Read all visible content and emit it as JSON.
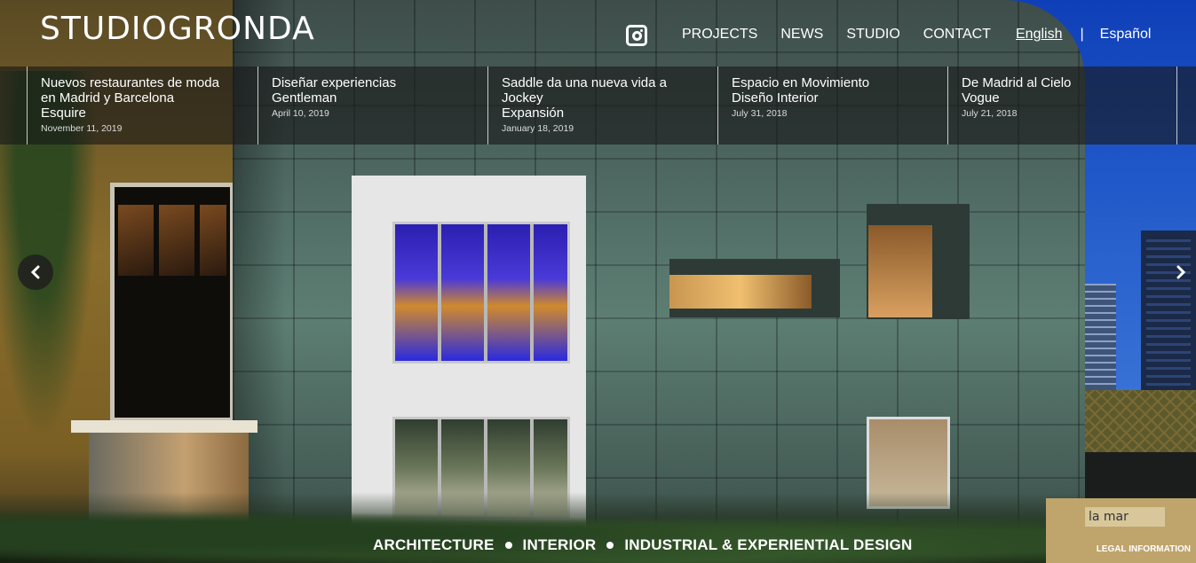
{
  "header": {
    "logo": "STUDIOGRONDA",
    "nav": [
      "PROJECTS",
      "NEWS",
      "STUDIO",
      "CONTACT"
    ],
    "languages": {
      "active": "English",
      "separator": "|",
      "other": "Español"
    },
    "social_icon": "instagram-icon"
  },
  "news": [
    {
      "title_lines": [
        "Nuevos restaurantes de moda",
        "en Madrid y Barcelona",
        "Esquire"
      ],
      "date": "November 11, 2019"
    },
    {
      "title_lines": [
        "Diseñar experiencias",
        "Gentleman"
      ],
      "date": "April 10, 2019"
    },
    {
      "title_lines": [
        "Saddle da una nueva vida a",
        "Jockey",
        "Expansión"
      ],
      "date": "January 18, 2019"
    },
    {
      "title_lines": [
        "Espacio en Movimiento",
        "Diseño Interior"
      ],
      "date": "July 31, 2018"
    },
    {
      "title_lines": [
        "De Madrid al Cielo",
        "Vogue"
      ],
      "date": "July 21, 2018"
    }
  ],
  "carousel": {
    "prev_icon": "chevron-left-icon",
    "next_icon": "chevron-right-icon"
  },
  "sign_text": "la mar",
  "footer": {
    "disciplines": [
      "ARCHITECTURE",
      "INTERIOR",
      "INDUSTRIAL & EXPERIENTIAL DESIGN"
    ],
    "legal": "LEGAL INFORMATION"
  }
}
